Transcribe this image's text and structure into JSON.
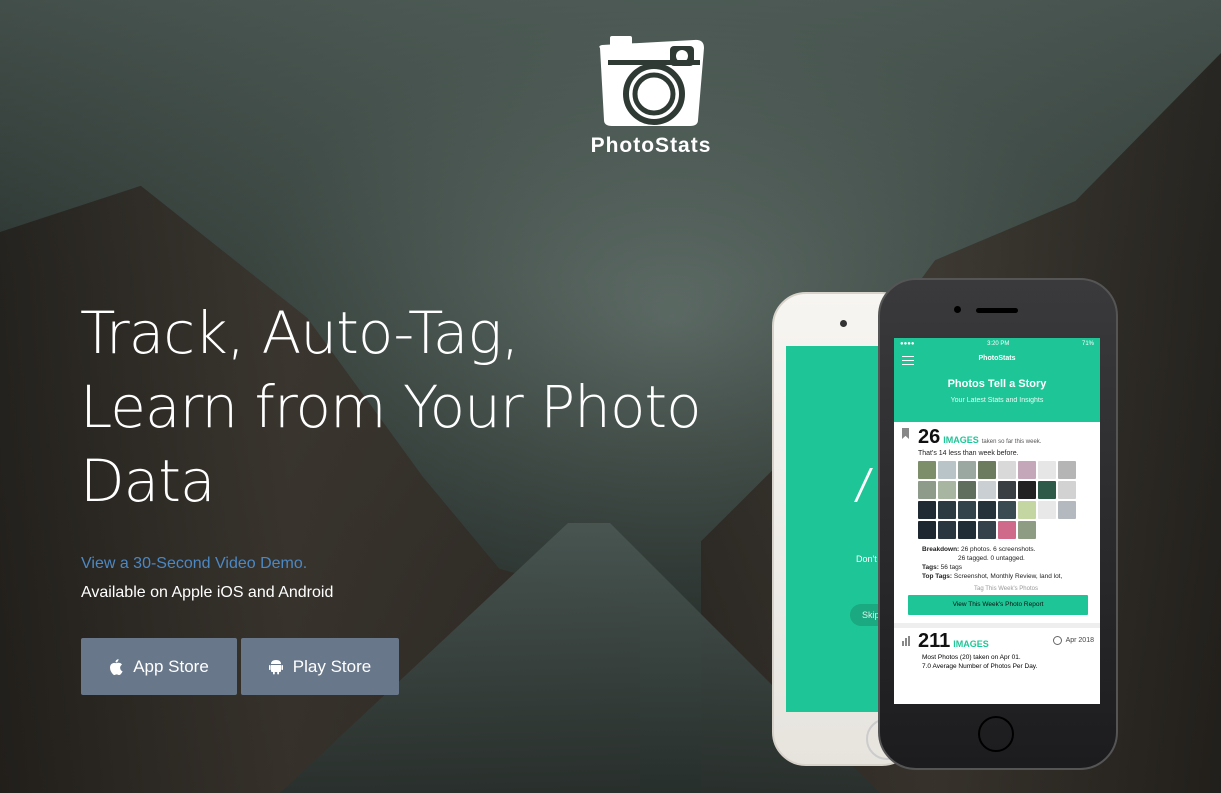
{
  "brand": {
    "name": "PhotoStats"
  },
  "hero": {
    "headline": [
      "Track, Auto-Tag,",
      "Learn from Your Photo",
      "Data"
    ],
    "demo_link": "View a 30-Second Video Demo.",
    "available": "Available on Apple iOS and Android"
  },
  "buttons": {
    "app_store": "App Store",
    "play_store": "Play Store"
  },
  "phone_white": {
    "text": "Don't Lo",
    "skip": "Skip"
  },
  "phone_black": {
    "status_time": "3:20 PM",
    "status_battery": "71%",
    "app_title": "PhotoStats",
    "hero_title": "Photos Tell a Story",
    "hero_sub": "Your Latest Stats and Insights",
    "week": {
      "count": "26",
      "label": "IMAGES",
      "note": "taken so far this week.",
      "compare": "That's 14 less than week before.",
      "breakdown_label": "Breakdown:",
      "breakdown_text": "26 photos. 6 screenshots.",
      "breakdown_text2": "26 tagged. 0 untagged.",
      "tags_label": "Tags:",
      "tags_text": "56 tags",
      "top_tags_label": "Top Tags:",
      "top_tags_text": "Screenshot, Monthly Review, land lot,",
      "tag_cta": "Tag This Week's Photos",
      "report_button": "View This Week's Photo Report"
    },
    "month": {
      "count": "211",
      "label": "IMAGES",
      "date": "Apr 2018",
      "line1": "Most Photos (20) taken on Apr 01.",
      "line2": "7.0 Average Number of Photos Per Day."
    }
  },
  "colors": {
    "accent": "#1ec697",
    "button_bg": "#68778a",
    "link": "#4c88c4"
  }
}
